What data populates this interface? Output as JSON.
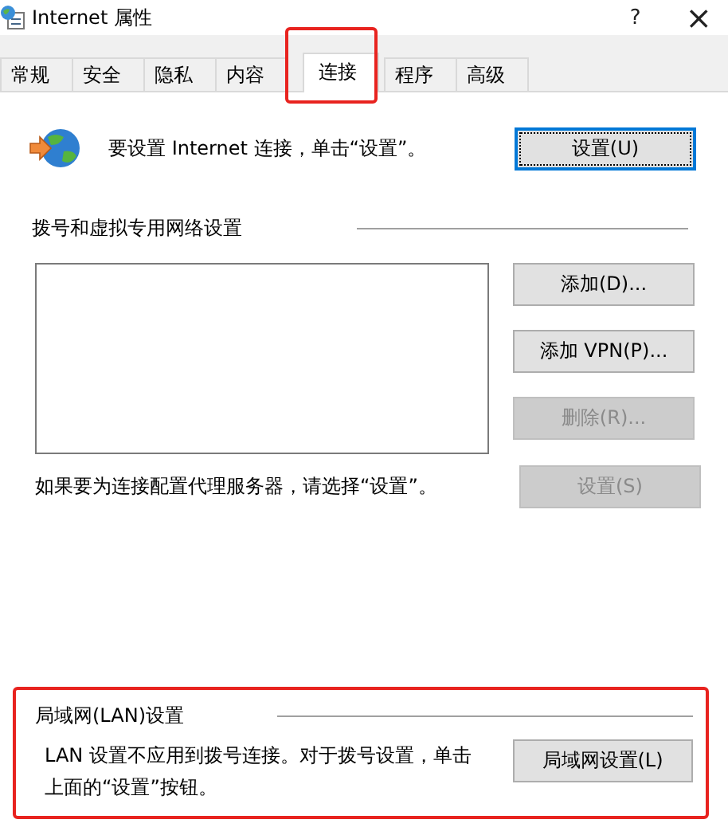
{
  "window": {
    "title": "Internet 属性",
    "help": "?",
    "close": "×"
  },
  "tabs": [
    {
      "label": "常规",
      "selected": false,
      "highlighted": false
    },
    {
      "label": "安全",
      "selected": false,
      "highlighted": false
    },
    {
      "label": "隐私",
      "selected": false,
      "highlighted": false
    },
    {
      "label": "内容",
      "selected": false,
      "highlighted": false
    },
    {
      "label": "连接",
      "selected": true,
      "highlighted": true
    },
    {
      "label": "程序",
      "selected": false,
      "highlighted": false
    },
    {
      "label": "高级",
      "selected": false,
      "highlighted": false
    }
  ],
  "setup": {
    "text": "要设置 Internet 连接，单击“设置”。",
    "button": {
      "label": "设置(U)",
      "disabled": false,
      "focused": true
    }
  },
  "vpn_section": {
    "heading": "拨号和虚拟专用网络设置",
    "buttons": [
      {
        "label": "添加(D)...",
        "disabled": false
      },
      {
        "label": "添加 VPN(P)...",
        "disabled": false
      },
      {
        "label": "删除(R)...",
        "disabled": true
      }
    ],
    "proxy_text": "如果要为连接配置代理服务器，请选择“设置”。",
    "proxy_button": {
      "label": "设置(S)",
      "disabled": true
    }
  },
  "lan_section": {
    "heading": "局域网(LAN)设置",
    "text": "LAN 设置不应用到拨号连接。对于拨号设置，单击上面的“设置”按钮。",
    "button": {
      "label": "局域网设置(L)",
      "disabled": false,
      "focused": false
    },
    "highlighted": true
  }
}
